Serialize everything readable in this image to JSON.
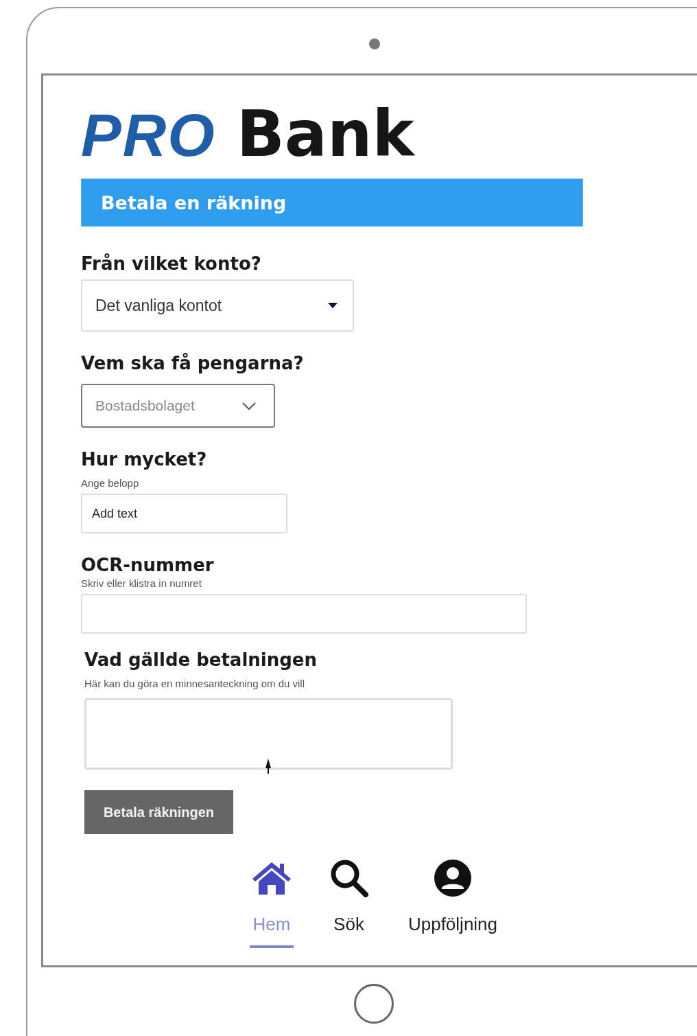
{
  "logo": {
    "brand": "PRO",
    "name": "Bank"
  },
  "title": "Betala en räkning",
  "fields": [
    {
      "kind": "select",
      "label": "Från vilket konto?",
      "value": "Det vanliga kontot"
    },
    {
      "kind": "dropdown",
      "label": "Vem ska få pengarna?",
      "value": "Bostadsbolaget"
    },
    {
      "kind": "input",
      "label": "Hur mycket?",
      "hint": "Ange belopp",
      "placeholder": "Add text"
    },
    {
      "kind": "input",
      "label": "OCR-nummer",
      "hint": "Skriv eller klistra in numret"
    },
    {
      "kind": "textarea",
      "label": "Vad gällde betalningen",
      "hint": "Här kan du göra en minnesanteckning om du vill"
    }
  ],
  "submit": "Betala räkningen",
  "nav": [
    {
      "kind": "home",
      "label": "Hem",
      "selected": true
    },
    {
      "kind": "search",
      "label": "Sök",
      "selected": false
    },
    {
      "kind": "account",
      "label": "Uppföljning",
      "selected": false
    }
  ]
}
